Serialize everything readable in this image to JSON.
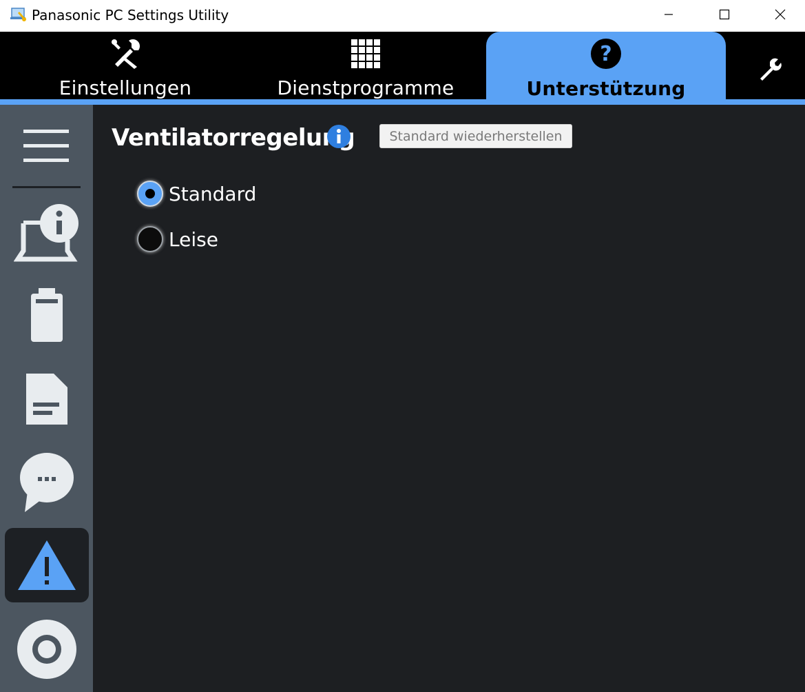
{
  "window": {
    "title": "Panasonic PC Settings Utility",
    "icon": "app-laptop-icon"
  },
  "tabs": [
    {
      "label": "Einstellungen",
      "icon": "tools-icon",
      "selected": false
    },
    {
      "label": "Dienstprogramme",
      "icon": "grid-icon",
      "selected": false
    },
    {
      "label": "Unterstützung",
      "icon": "question-icon",
      "selected": true
    }
  ],
  "sidebar": {
    "items": [
      {
        "name": "menu",
        "icon": "hamburger-icon"
      },
      {
        "name": "pc-info",
        "icon": "laptop-info-icon"
      },
      {
        "name": "battery",
        "icon": "battery-icon"
      },
      {
        "name": "document",
        "icon": "document-icon"
      },
      {
        "name": "messages",
        "icon": "chat-bubble-icon"
      },
      {
        "name": "warning",
        "icon": "warning-icon",
        "active": true
      },
      {
        "name": "disc",
        "icon": "disc-icon"
      }
    ]
  },
  "main": {
    "title": "Ventilatorregelung",
    "restore_button": "Standard wiederherstellen",
    "options": [
      {
        "label": "Standard",
        "checked": true
      },
      {
        "label": "Leise",
        "checked": false
      }
    ]
  },
  "colors": {
    "accent": "#5aa2f5",
    "content_bg": "#1d1f22",
    "sidebar_bg": "#4c5660",
    "tabbar_bg": "#000000"
  }
}
